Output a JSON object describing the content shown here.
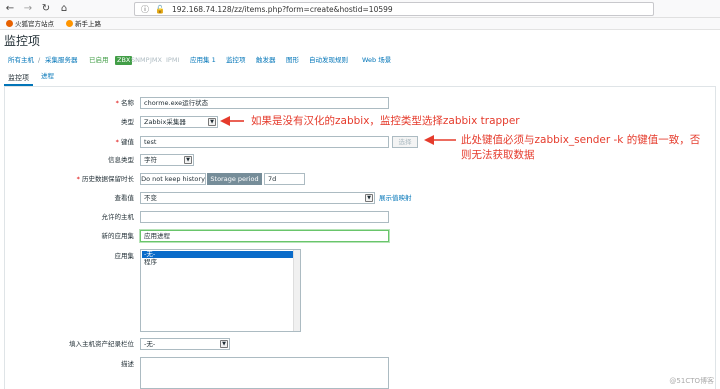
{
  "browser": {
    "back": "←",
    "forward": "→",
    "reload": "↻",
    "home": "⌂",
    "url": "192.168.74.128/zz/items.php?form=create&hostid=10599",
    "bookmarks": [
      "火狐官方站点",
      "新手上路"
    ]
  },
  "page": {
    "title": "监控项"
  },
  "breadcrumbs": {
    "all_hosts": "所有主机",
    "sep": "/",
    "host": "采集服务器",
    "enabled": "已启用",
    "zbx": "ZBX",
    "snmp": "SNMP",
    "jmx": "JMX",
    "ipmi": "IPMI",
    "applications": "应用集 1",
    "items": "监控项",
    "triggers": "触发器",
    "graphs": "图形",
    "discovery": "自动发现规则",
    "web": "Web 场景"
  },
  "tabs": {
    "item": "监控项",
    "process": "进程"
  },
  "form": {
    "name_label": "名称",
    "name_value": "chorme.exe运行状态",
    "type_label": "类型",
    "type_value": "Zabbix采集器",
    "key_label": "键值",
    "key_value": "test",
    "select_button": "选择",
    "info_type_label": "信息类型",
    "info_type_value": "字符",
    "history_label": "历史数据保留时长",
    "history_no_keep": "Do not keep history",
    "history_storage": "Storage period",
    "history_value": "7d",
    "show_value_label": "查看值",
    "show_value_value": "不变",
    "show_value_mapping": "展示值映射",
    "allowed_hosts_label": "允许的主机",
    "allowed_hosts_value": "",
    "new_app_label": "新的应用集",
    "new_app_value": "应用进程",
    "apps_label": "应用集",
    "apps_options": [
      "-无-",
      "程序"
    ],
    "inventory_label": "填入主机资产纪录栏位",
    "inventory_value": "-无-",
    "description_label": "描述"
  },
  "annotations": {
    "type_note": "如果是没有汉化的zabbix，监控类型选择zabbix trapper",
    "key_note_1": "此处键值必须与zabbix_sender -k 的键值一致，否",
    "key_note_2": "则无法获取数据"
  },
  "watermark": "@51CTO博客",
  "colors": {
    "link": "#0275b8",
    "annotation": "#e53b2c",
    "enabled": "#429e47"
  }
}
